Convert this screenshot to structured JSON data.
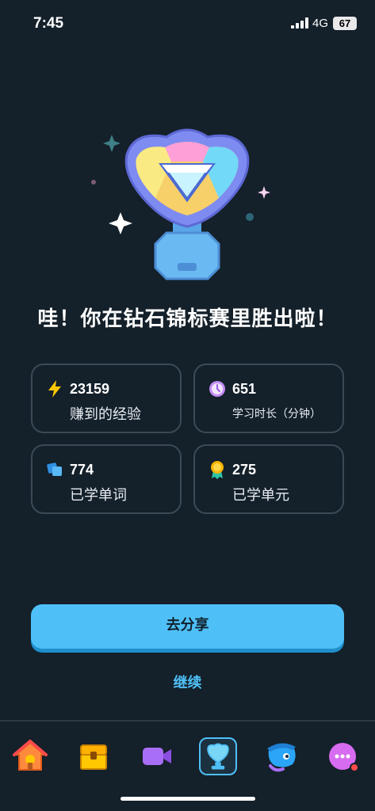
{
  "status_bar": {
    "time": "7:45",
    "network": "4G",
    "battery": "67"
  },
  "headline": "哇！你在钻石锦标赛里胜出啦！",
  "stats": [
    {
      "icon": "lightning-icon",
      "value": "23159",
      "label": "赚到的经验"
    },
    {
      "icon": "clock-icon",
      "value": "651",
      "label": "学习时长（分钟）"
    },
    {
      "icon": "cards-icon",
      "value": "774",
      "label": "已学单词"
    },
    {
      "icon": "medal-icon",
      "value": "275",
      "label": "已学单元"
    }
  ],
  "actions": {
    "share_label": "去分享",
    "continue_label": "继续"
  },
  "colors": {
    "background": "#14202a",
    "accent": "#4fc0f7",
    "card_border": "#3a4a56"
  },
  "tab_bar": {
    "tabs": [
      {
        "name": "home",
        "icon": "home-icon"
      },
      {
        "name": "treasure",
        "icon": "treasure-chest-icon"
      },
      {
        "name": "video",
        "icon": "video-camera-icon"
      },
      {
        "name": "leaderboard",
        "icon": "trophy-icon",
        "active": true
      },
      {
        "name": "characters",
        "icon": "character-icon"
      },
      {
        "name": "more",
        "icon": "more-icon"
      }
    ]
  }
}
